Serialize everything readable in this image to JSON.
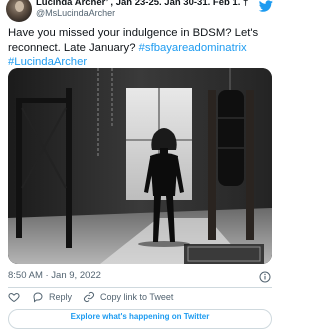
{
  "tweet": {
    "author_name": "Lucinda Archer’ , Jan 23-25. Jan 30-31. Feb 1. †",
    "handle": "@MsLucindaArcher",
    "text": "Have you missed your indulgence in BDSM? Let's reconnect. Late January?",
    "hashtags": [
      "#sfbayareadominatrix",
      "#LucindaArcher"
    ],
    "timestamp": "8:50 AM · Jan 9, 2022"
  },
  "actions": {
    "reply_label": "Reply",
    "copy_link_label": "Copy link to Tweet"
  },
  "explore_label": "Explore what's happening on Twitter",
  "icons": [
    "avatar",
    "twitter-bird-icon",
    "info-icon",
    "heart-icon",
    "reply-icon",
    "link-icon"
  ],
  "colors": {
    "accent": "#1d9bf0",
    "text": "#0f1419",
    "muted": "#536471",
    "border": "#cfd9de"
  }
}
